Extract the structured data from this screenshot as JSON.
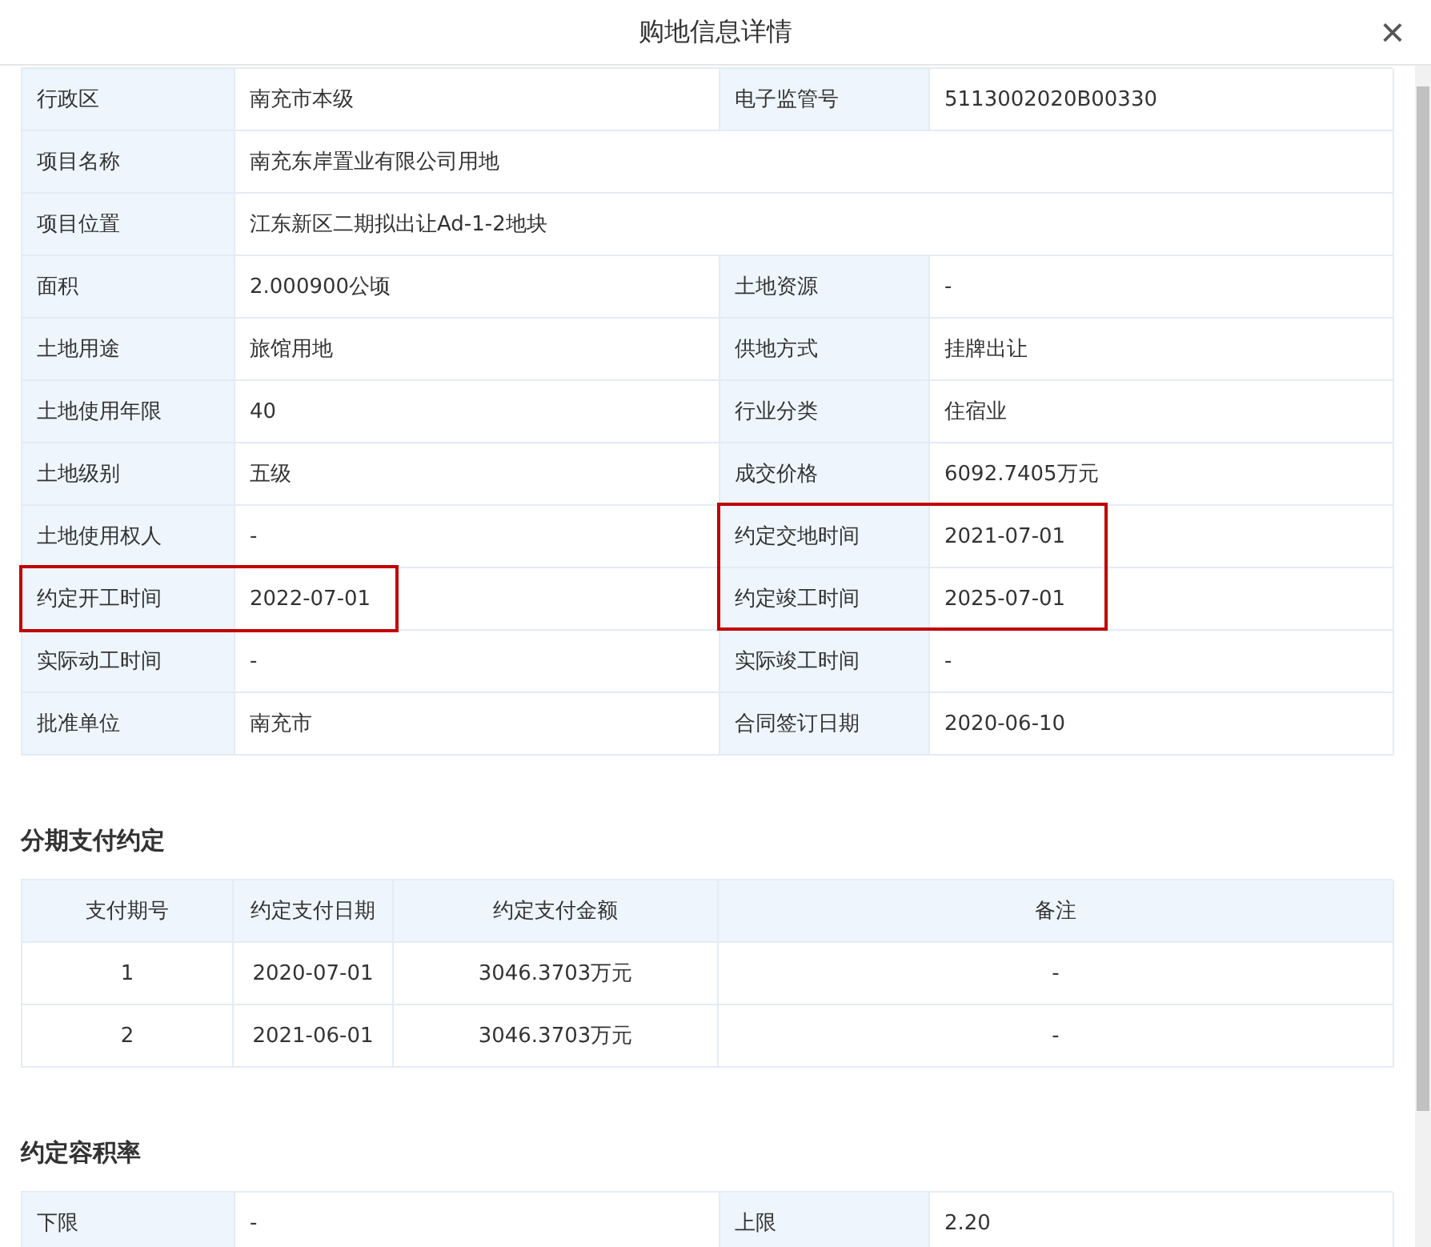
{
  "dialog": {
    "title": "购地信息详情",
    "close_icon": "×"
  },
  "detail_rows": [
    {
      "fields": [
        {
          "label": "行政区",
          "value": "南充市本级",
          "highlighted": false
        },
        {
          "label": "电子监管号",
          "value": "5113002020B00330",
          "highlighted": false
        }
      ]
    },
    {
      "fields": [
        {
          "label": "项目名称",
          "value": "南充东岸置业有限公司用地",
          "highlighted": false
        }
      ]
    },
    {
      "fields": [
        {
          "label": "项目位置",
          "value": "江东新区二期拟出让Ad-1-2地块",
          "highlighted": false
        }
      ]
    },
    {
      "fields": [
        {
          "label": "面积",
          "value": "2.000900公顷",
          "highlighted": false
        },
        {
          "label": "土地资源",
          "value": "-",
          "highlighted": false
        }
      ]
    },
    {
      "fields": [
        {
          "label": "土地用途",
          "value": "旅馆用地",
          "highlighted": false
        },
        {
          "label": "供地方式",
          "value": "挂牌出让",
          "highlighted": false
        }
      ]
    },
    {
      "fields": [
        {
          "label": "土地使用年限",
          "value": "40",
          "highlighted": false
        },
        {
          "label": "行业分类",
          "value": "住宿业",
          "highlighted": false
        }
      ]
    },
    {
      "fields": [
        {
          "label": "土地级别",
          "value": "五级",
          "highlighted": false
        },
        {
          "label": "成交价格",
          "value": "6092.7405万元",
          "highlighted": false
        }
      ]
    },
    {
      "fields": [
        {
          "label": "土地使用权人",
          "value": "-",
          "highlighted": false
        },
        {
          "label": "约定交地时间",
          "value": "2021-07-01",
          "highlighted": true
        }
      ]
    },
    {
      "fields": [
        {
          "label": "约定开工时间",
          "value": "2022-07-01",
          "highlighted": true
        },
        {
          "label": "约定竣工时间",
          "value": "2025-07-01",
          "highlighted": true
        }
      ]
    },
    {
      "fields": [
        {
          "label": "实际动工时间",
          "value": "-",
          "highlighted": false
        },
        {
          "label": "实际竣工时间",
          "value": "-",
          "highlighted": false
        }
      ]
    },
    {
      "fields": [
        {
          "label": "批准单位",
          "value": "南充市",
          "highlighted": false
        },
        {
          "label": "合同签订日期",
          "value": "2020-06-10",
          "highlighted": false
        }
      ]
    }
  ],
  "payment_section": {
    "title": "分期支付约定",
    "columns": [
      "支付期号",
      "约定支付日期",
      "约定支付金额",
      "备注"
    ],
    "rows": [
      [
        "1",
        "2020-07-01",
        "3046.3703万元",
        "-"
      ],
      [
        "2",
        "2021-06-01",
        "3046.3703万元",
        "-"
      ]
    ]
  },
  "far_section": {
    "title": "约定容积率",
    "fields": [
      {
        "label": "下限",
        "value": "-"
      },
      {
        "label": "上限",
        "value": "2.20"
      }
    ]
  }
}
